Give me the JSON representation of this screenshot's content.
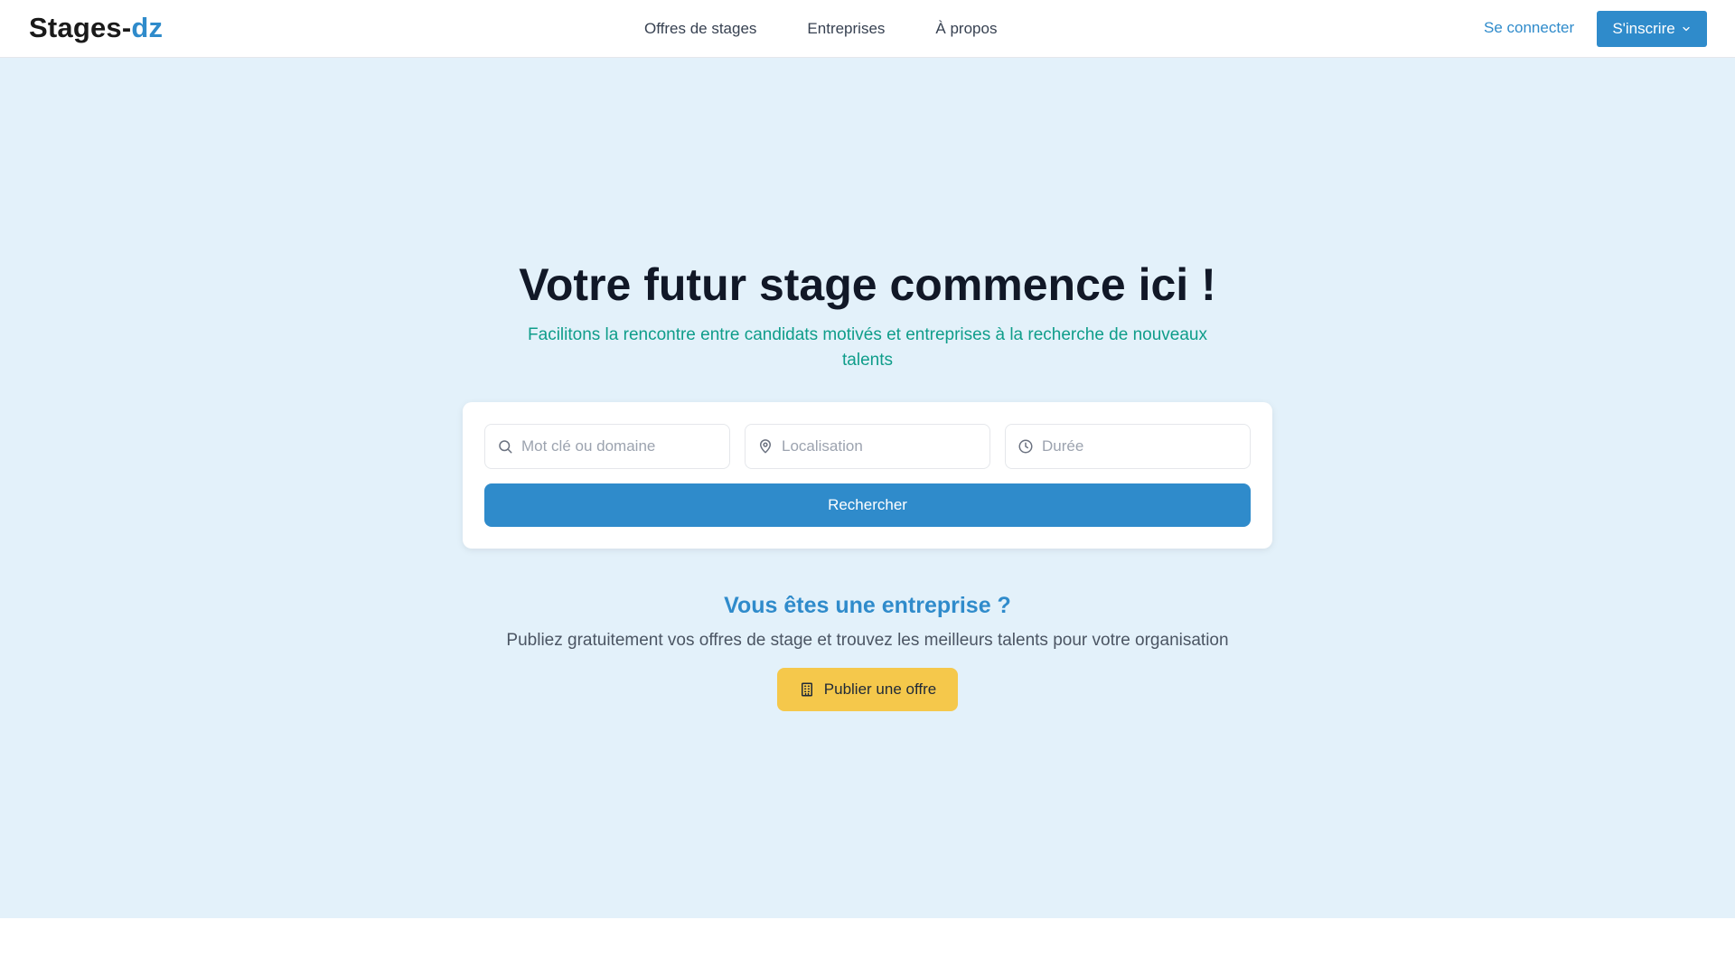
{
  "navbar": {
    "logo_main": "Stages-",
    "logo_accent": "dz",
    "links": [
      {
        "label": "Offres de stages"
      },
      {
        "label": "Entreprises"
      },
      {
        "label": "À propos"
      }
    ],
    "login_label": "Se connecter",
    "signup_label": "S'inscrire"
  },
  "hero": {
    "title": "Votre futur stage commence ici !",
    "subtitle": "Facilitons la rencontre entre candidats motivés et entreprises à la recherche de nouveaux talents"
  },
  "search": {
    "keyword": {
      "placeholder": "Mot clé ou domaine",
      "value": "",
      "icon": "search-icon"
    },
    "location": {
      "placeholder": "Localisation",
      "value": "",
      "icon": "map-pin-icon"
    },
    "duration": {
      "placeholder": "Durée",
      "value": "",
      "icon": "clock-icon"
    },
    "button_label": "Rechercher"
  },
  "business": {
    "title": "Vous êtes une entreprise ?",
    "subtitle": "Publiez gratuitement vos offres de stage et trouvez les meilleurs talents pour votre organisation",
    "publish_label": "Publier une offre",
    "publish_icon": "building-icon"
  },
  "colors": {
    "primary": "#2f8bcb",
    "hero_bg": "#e3f1fa",
    "subtitle_teal": "#0f9d8a",
    "publish_yellow": "#f5c84b",
    "title_dark": "#111827"
  }
}
